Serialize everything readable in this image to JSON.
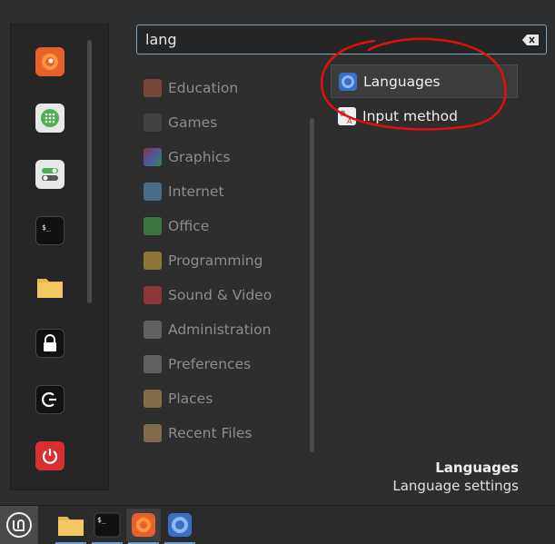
{
  "search": {
    "value": "lang"
  },
  "favorites": [
    "firefox-icon",
    "software-manager-icon",
    "settings-icon",
    "terminal-icon",
    "files-icon",
    "lock-icon",
    "logout-icon",
    "power-icon"
  ],
  "categories": [
    {
      "label": "Education",
      "icon": "education-icon",
      "color": "#b85c3c"
    },
    {
      "label": "Games",
      "icon": "games-icon",
      "color": "#555555"
    },
    {
      "label": "Graphics",
      "icon": "graphics-icon",
      "color": "#8f5fd0"
    },
    {
      "label": "Internet",
      "icon": "internet-icon",
      "color": "#5aa0d8"
    },
    {
      "label": "Office",
      "icon": "office-icon",
      "color": "#4caf50"
    },
    {
      "label": "Programming",
      "icon": "programming-icon",
      "color": "#d8b040"
    },
    {
      "label": "Sound & Video",
      "icon": "sound-video-icon",
      "color": "#d84040"
    },
    {
      "label": "Administration",
      "icon": "administration-icon",
      "color": "#8a8a8a"
    },
    {
      "label": "Preferences",
      "icon": "preferences-icon",
      "color": "#8a8a8a"
    },
    {
      "label": "Places",
      "icon": "places-icon",
      "color": "#c8a060"
    },
    {
      "label": "Recent Files",
      "icon": "recent-files-icon",
      "color": "#c8a060"
    }
  ],
  "results": [
    {
      "label": "Languages",
      "icon": "languages-icon",
      "selected": true
    },
    {
      "label": "Input method",
      "icon": "input-method-icon",
      "selected": false
    }
  ],
  "description": {
    "title": "Languages",
    "subtitle": "Language settings"
  },
  "taskbar": [
    "mint-menu-icon",
    "files-icon",
    "terminal-icon",
    "firefox-icon",
    "languages-icon"
  ]
}
